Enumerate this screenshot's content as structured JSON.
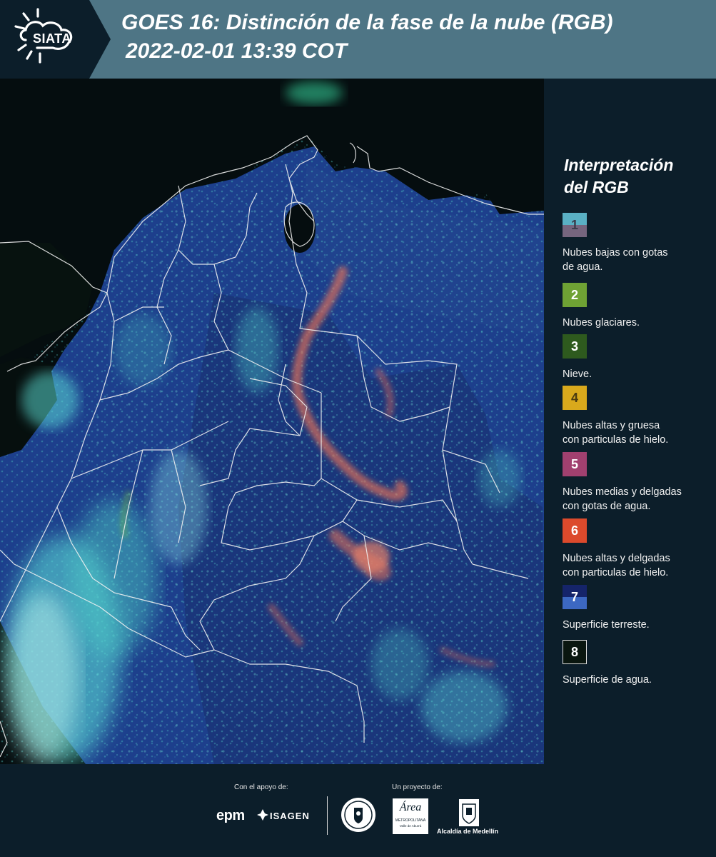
{
  "header": {
    "logo_text": "SIATA",
    "title": "GOES 16: Distinción de la fase de la nube (RGB)",
    "subtitle": "2022-02-01 13:39 COT"
  },
  "legend": {
    "title_line1": "Interpretación",
    "title_line2": "del RGB",
    "items": [
      {
        "number": "1",
        "label_line1": "Nubes bajas con gotas",
        "label_line2": "de agua.",
        "color_top": "#5ab0c4",
        "color_bottom": "#76657e"
      },
      {
        "number": "2",
        "label_line1": "Nubes glaciares.",
        "label_line2": "",
        "color": "#6fa234"
      },
      {
        "number": "3",
        "label_line1": "Nieve.",
        "label_line2": "",
        "color": "#2e5a1e"
      },
      {
        "number": "4",
        "label_line1": "Nubes altas y gruesa",
        "label_line2": "con particulas de hielo.",
        "color": "#d9a91c"
      },
      {
        "number": "5",
        "label_line1": "Nubes medias y delgadas",
        "label_line2": "con gotas de agua.",
        "color": "#a1406f"
      },
      {
        "number": "6",
        "label_line1": "Nubes altas y delgadas",
        "label_line2": "con particulas de hielo.",
        "color": "#dc4a2c"
      },
      {
        "number": "7",
        "label_line1": "Superficie terreste.",
        "label_line2": "",
        "color_top": "#15246a",
        "color_bottom": "#3c68c2"
      },
      {
        "number": "8",
        "label_line1": "Superficie de agua.",
        "label_line2": "",
        "color": "#0a160f"
      }
    ]
  },
  "footer": {
    "support_label": "Con el apoyo de:",
    "project_label": "Un proyecto de:",
    "sponsor_epm": "epm",
    "sponsor_isagen": "ISAGEN",
    "area_text_1": "Área",
    "area_text_2": "METROPOLITANA",
    "area_text_3": "Valle de Aburrá",
    "alcaldia": "Alcaldía de Medellín"
  },
  "colors": {
    "header_bg": "#4e7585",
    "panel_bg": "#0c1e2a",
    "land_blue": "#1d3f8c",
    "cloud_cyan": "#47d9d0",
    "ice_red": "#e0705a"
  }
}
